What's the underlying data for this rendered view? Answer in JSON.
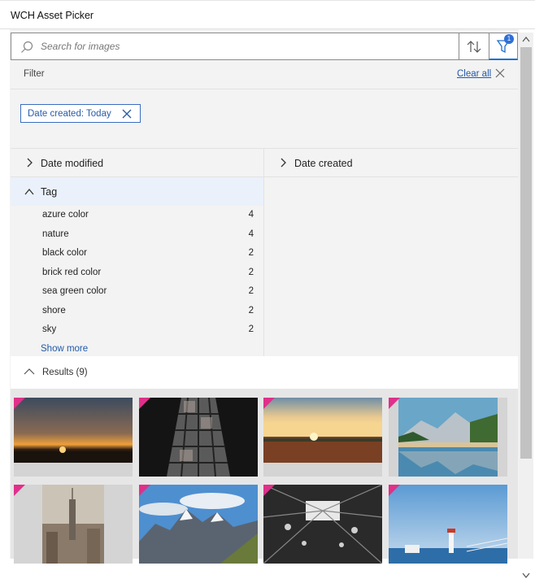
{
  "window": {
    "title": "WCH Asset Picker"
  },
  "search": {
    "placeholder": "Search for images",
    "value": ""
  },
  "toolbar": {
    "sort_icon": "sort-arrows-icon",
    "filter_icon": "filter-funnel-icon",
    "filter_badge": "1"
  },
  "filter": {
    "label": "Filter",
    "clear_all": "Clear all",
    "active_chips": [
      {
        "label": "Date created: Today"
      }
    ]
  },
  "facets": {
    "date_modified": "Date modified",
    "date_created": "Date created",
    "tag": {
      "label": "Tag",
      "items": [
        {
          "name": "azure color",
          "count": "4"
        },
        {
          "name": "nature",
          "count": "4"
        },
        {
          "name": "black color",
          "count": "2"
        },
        {
          "name": "brick red color",
          "count": "2"
        },
        {
          "name": "sea green color",
          "count": "2"
        },
        {
          "name": "shore",
          "count": "2"
        },
        {
          "name": "sky",
          "count": "2"
        }
      ],
      "show_more": "Show more"
    }
  },
  "results": {
    "label": "Results (9)",
    "thumbnails": [
      {
        "name": "sunset-silhouette-image"
      },
      {
        "name": "stained-glass-window-image"
      },
      {
        "name": "sunset-field-image"
      },
      {
        "name": "mountain-lake-reflection-image"
      },
      {
        "name": "city-skyline-image"
      },
      {
        "name": "snowy-mountains-image"
      },
      {
        "name": "industrial-hall-image"
      },
      {
        "name": "lighthouse-coast-image"
      }
    ]
  },
  "colors": {
    "accent": "#1f6fd1",
    "link": "#2159a8",
    "badge": "#2f6fd6",
    "corner_tag": "#e0308a",
    "tag_header_bg": "#eaf1fb"
  }
}
